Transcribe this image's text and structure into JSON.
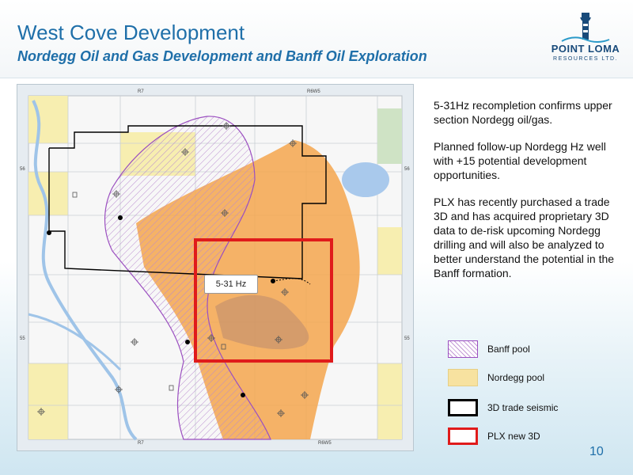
{
  "header": {
    "title": "West Cove Development",
    "subtitle": "Nordegg Oil and Gas Development and Banff Oil Exploration"
  },
  "logo": {
    "name": "POINT LOMA",
    "subtitle": "RESOURCES LTD."
  },
  "map": {
    "grid_labels": {
      "top_left_range": "R7",
      "top_right_range": "R6W5",
      "bottom_left_range": "R7",
      "bottom_right_range": "R6W5",
      "left_top_township": "56",
      "left_bottom_township": "55",
      "right_top_township": "56",
      "right_bottom_township": "55"
    },
    "well_label": "5-31 Hz",
    "colors": {
      "banff_pool": "#c39ad6",
      "nordegg_pool": "#f4a64e",
      "seismic_outline": "#000000",
      "new_3d": "#e01b1b",
      "water": "#a9c9ec"
    }
  },
  "bullets": [
    "5-31Hz recompletion confirms upper section Nordegg oil/gas.",
    "Planned follow-up Nordegg Hz well with +15 potential development opportunities.",
    "PLX has recently purchased a trade 3D and has acquired proprietary 3D data to de-risk upcoming Nordegg drilling and will also be analyzed to better understand the potential in the Banff formation."
  ],
  "legend": [
    {
      "label": "Banff pool",
      "swatch": "banff"
    },
    {
      "label": "Nordegg pool",
      "swatch": "nordegg"
    },
    {
      "label": "3D trade seismic",
      "swatch": "seismic"
    },
    {
      "label": "PLX new 3D",
      "swatch": "plx"
    }
  ],
  "page_number": "10"
}
